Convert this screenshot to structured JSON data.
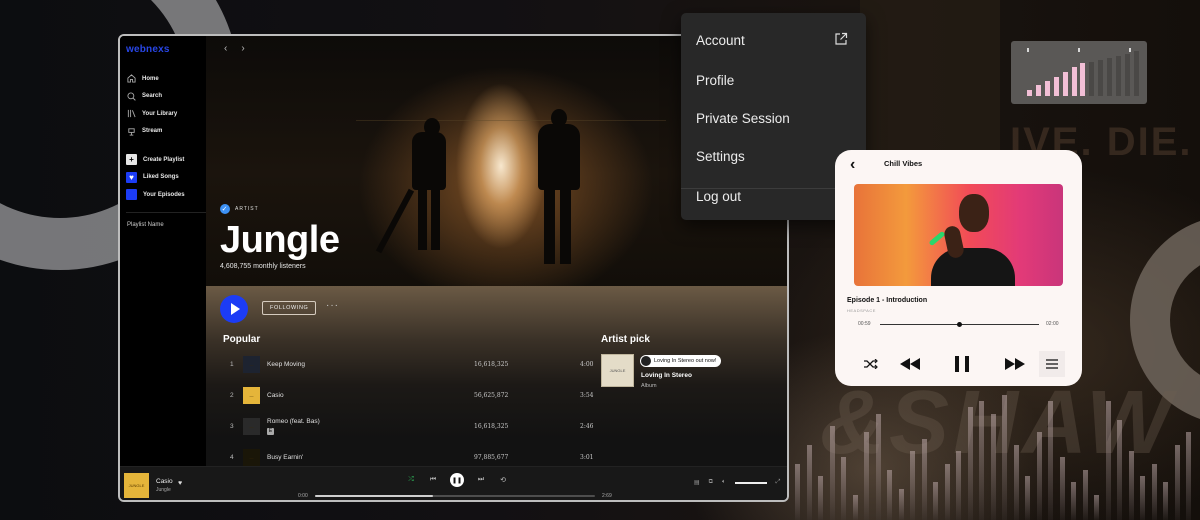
{
  "background": {
    "text_top": "IVE. DIE. RE",
    "text_bottom": "&SHAW",
    "eq_levels": [
      0.45,
      0.6,
      0.35,
      0.75,
      0.5,
      0.2,
      0.7,
      0.85,
      0.4,
      0.25,
      0.55,
      0.65,
      0.3,
      0.45,
      0.55,
      0.9,
      0.95,
      0.85,
      1.0,
      0.6,
      0.35,
      0.7,
      0.95,
      0.5,
      0.3,
      0.4,
      0.2,
      0.95,
      0.8,
      0.55,
      0.35,
      0.45,
      0.3,
      0.6,
      0.7
    ]
  },
  "level_card": {
    "levels_active": [
      0.18,
      0.3,
      0.42,
      0.54,
      0.66,
      0.8,
      0.92
    ],
    "levels_inactive": [
      0.95,
      1.0,
      1.05,
      1.1,
      1.18,
      1.25
    ],
    "active_color": "#f2bfd6",
    "inactive_color": "#4a4846"
  },
  "app": {
    "logo": "webnexs",
    "nav": [
      {
        "label": "Home",
        "icon": "home-icon"
      },
      {
        "label": "Search",
        "icon": "search-icon"
      },
      {
        "label": "Your Library",
        "icon": "library-icon"
      },
      {
        "label": "Stream",
        "icon": "stream-icon"
      }
    ],
    "library": [
      {
        "label": "Create Playlist",
        "icon": "plus-icon",
        "color": "#e6e6e6",
        "glyph": "+"
      },
      {
        "label": "Liked Songs",
        "icon": "heart-icon",
        "color": "#1c3cf5",
        "glyph": "♥"
      },
      {
        "label": "Your Episodes",
        "icon": "episodes-icon",
        "color": "#1c3cf5",
        "glyph": ""
      }
    ],
    "playlist_name": "Playlist Name",
    "nav_back": "‹",
    "nav_forward": "›",
    "artist": {
      "badge": "ARTIST",
      "name": "Jungle",
      "listeners": "4,608,755 monthly listeners"
    },
    "actions": {
      "follow_label": "FOLLOWING",
      "more_label": "···"
    },
    "popular": {
      "title": "Popular",
      "tracks": [
        {
          "num": "1",
          "title": "Keep Moving",
          "plays": "16,618,325",
          "duration": "4:00",
          "art_color": "#1d2330",
          "explicit": false
        },
        {
          "num": "2",
          "title": "Casio",
          "plays": "56,625,872",
          "duration": "3:54",
          "art_color": "#e5b53a",
          "explicit": false
        },
        {
          "num": "3",
          "title": "Romeo (feat. Bas)",
          "plays": "16,618,325",
          "duration": "2:46",
          "art_color": "#2a2a2a",
          "explicit": true,
          "explicit_label": "E"
        },
        {
          "num": "4",
          "title": "Busy Earnin'",
          "plays": "97,885,677",
          "duration": "3:01",
          "art_color": "#1a1608",
          "explicit": false
        }
      ]
    },
    "artist_pick": {
      "title": "Artist pick",
      "pill": "Loving In Stereo out now!",
      "name": "Loving In Stereo",
      "type": "Album",
      "art_label": "JUNGLE"
    },
    "player": {
      "title": "Casio",
      "artist": "Jungle",
      "art_label": "JUNGLE",
      "time_elapsed": "0:00",
      "time_total": "2:69",
      "progress": 0.42,
      "volume": 1.0
    }
  },
  "menu": {
    "items": [
      "Account",
      "Profile",
      "Private Session",
      "Settings",
      "Log out"
    ]
  },
  "podcast": {
    "title": "Chill Vibes",
    "episode": "Episode 1 - Introduction",
    "show": "HEADSPACE",
    "time_elapsed": "00:59",
    "time_total": "02:00",
    "progress": 0.5
  }
}
